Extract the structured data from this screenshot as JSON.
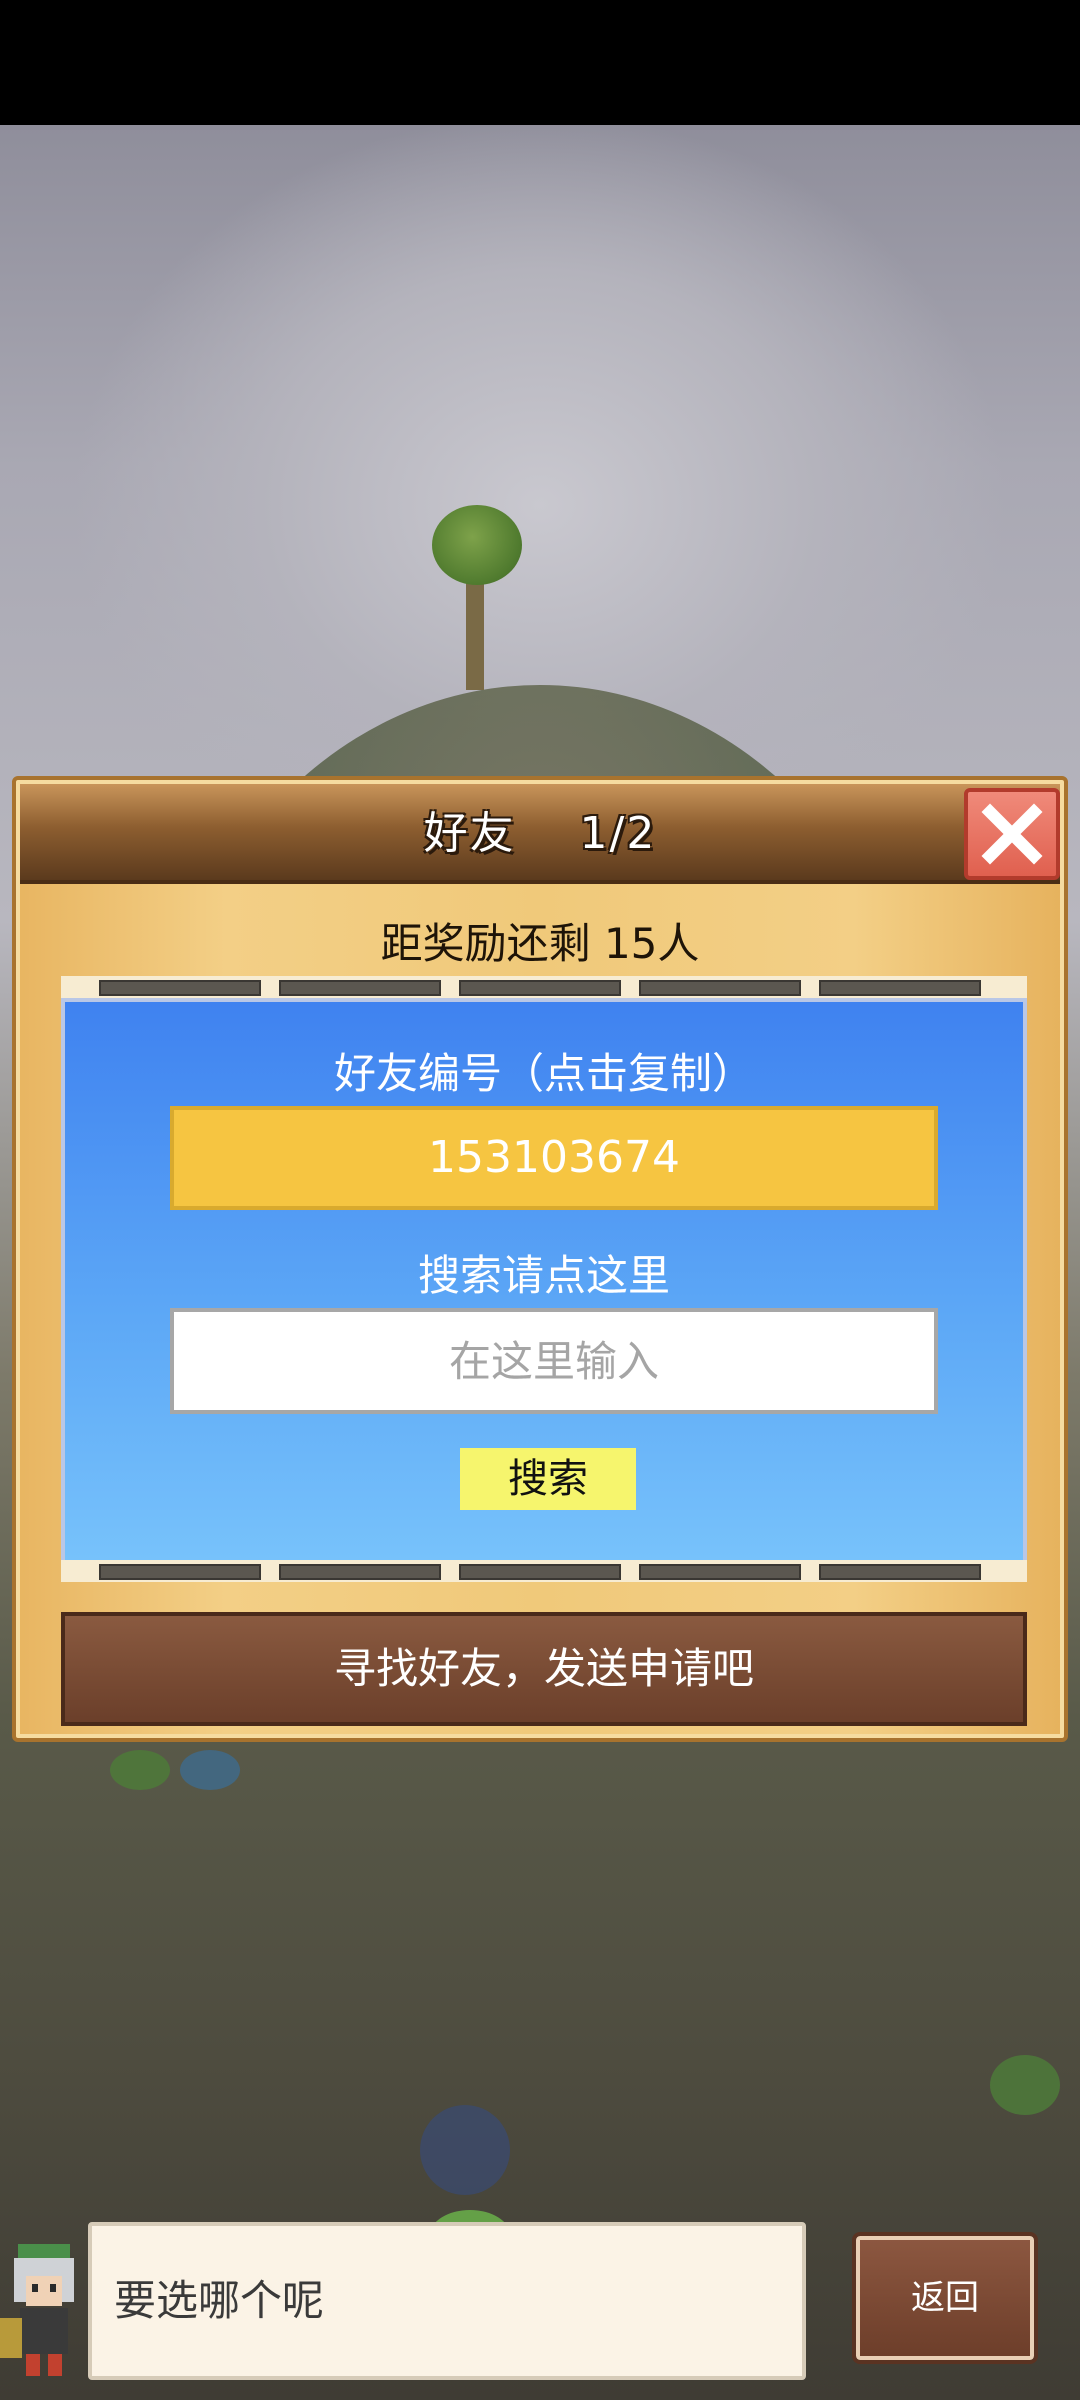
{
  "dialog": {
    "title": "好友    1/2",
    "reward_text": "距奖励还剩 15人",
    "friend_id_label": "好友编号（点击复制）",
    "friend_id_value": "153103674",
    "search_label": "搜索请点这里",
    "search_placeholder": "在这里输入",
    "search_button": "搜索",
    "find_friends_button": "寻找好友，发送申请吧"
  },
  "bottom": {
    "speech_text": "要选哪个呢",
    "back_button": "返回"
  },
  "icons": {
    "close": "close-icon",
    "prev": "arrow-left-icon",
    "next": "arrow-right-icon",
    "avatar": "character-avatar"
  },
  "colors": {
    "panel_blue": "#3f82f0",
    "id_box": "#f6c541",
    "search_button": "#f6f56d",
    "close_red": "#e0604f",
    "wood_brown": "#6b3f2a"
  }
}
